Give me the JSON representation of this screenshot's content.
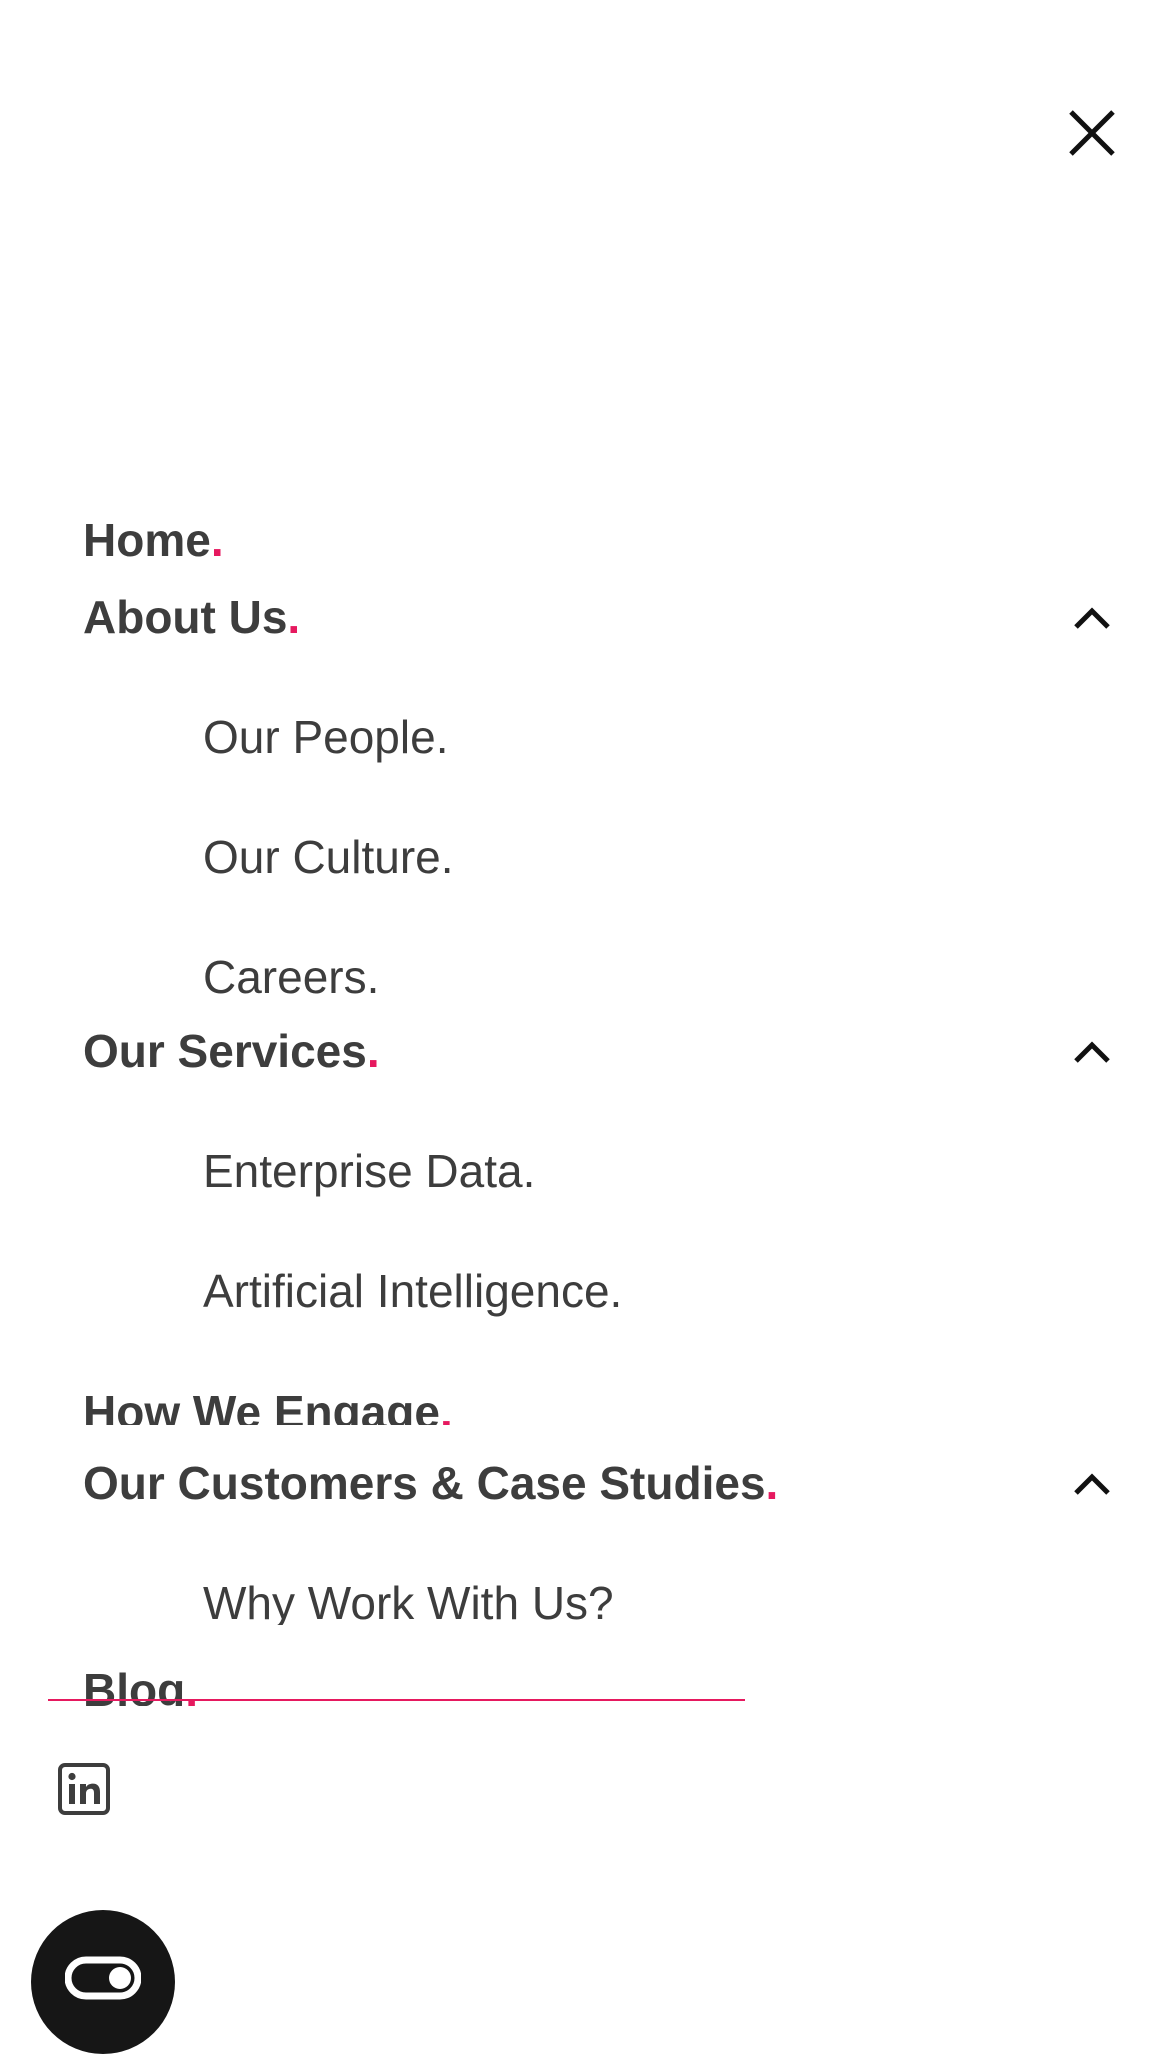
{
  "menu": {
    "close_icon": "close-icon",
    "items": [
      {
        "label": "Home",
        "dot": "."
      },
      {
        "label": "About Us",
        "dot": ".",
        "expanded": true,
        "children": [
          "Our People.",
          "Our Culture.",
          "Careers."
        ]
      },
      {
        "label": "Our Services",
        "dot": ".",
        "expanded": true,
        "children": [
          "Enterprise Data.",
          "Artificial Intelligence."
        ]
      },
      {
        "label": "How We Engage",
        "dot": "."
      },
      {
        "label": "Our Customers & Case Studies",
        "dot": ".",
        "expanded": true,
        "children": [
          "Why Work With Us?"
        ]
      },
      {
        "label": "Blog",
        "dot": "."
      }
    ]
  },
  "social": {
    "linkedin_icon": "linkedin-icon"
  },
  "chat": {
    "icon": "chat-toggle-icon"
  },
  "colors": {
    "text": "#3d3d3d",
    "accent": "#e6195f",
    "background": "#ffffff",
    "chat_bubble": "#161616"
  }
}
